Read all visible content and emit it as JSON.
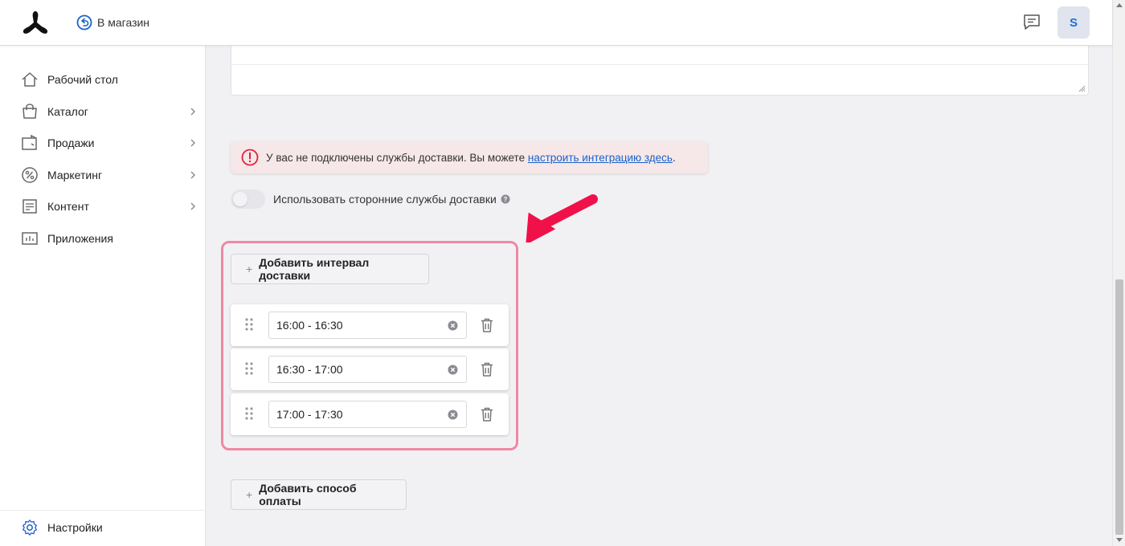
{
  "header": {
    "store_link": "В магазин",
    "avatar_letter": "S"
  },
  "sidebar": {
    "items": [
      {
        "label": "Рабочий стол",
        "icon": "home-icon"
      },
      {
        "label": "Каталог",
        "icon": "bag-icon"
      },
      {
        "label": "Продажи",
        "icon": "sales-icon"
      },
      {
        "label": "Маркетинг",
        "icon": "percent-icon"
      },
      {
        "label": "Контент",
        "icon": "content-icon"
      },
      {
        "label": "Приложения",
        "icon": "apps-icon"
      }
    ],
    "settings_label": "Настройки"
  },
  "alert": {
    "text": "У вас не подключены службы доставки. Вы можете ",
    "link": "настроить интеграцию здесь",
    "suffix": "."
  },
  "toggle": {
    "label": "Использовать сторонние службы доставки"
  },
  "intervals": {
    "add_button": "Добавить интервал доставки",
    "items": [
      "16:00 - 16:30",
      "16:30 - 17:00",
      "17:00 - 17:30"
    ]
  },
  "payment": {
    "add_button": "Добавить способ оплаты"
  },
  "colors": {
    "accent": "#1a62c9",
    "highlight": "#ef88a3",
    "arrow": "#f0104a",
    "alert_bg": "#f6e7e8",
    "alert_icon": "#e0203c"
  }
}
